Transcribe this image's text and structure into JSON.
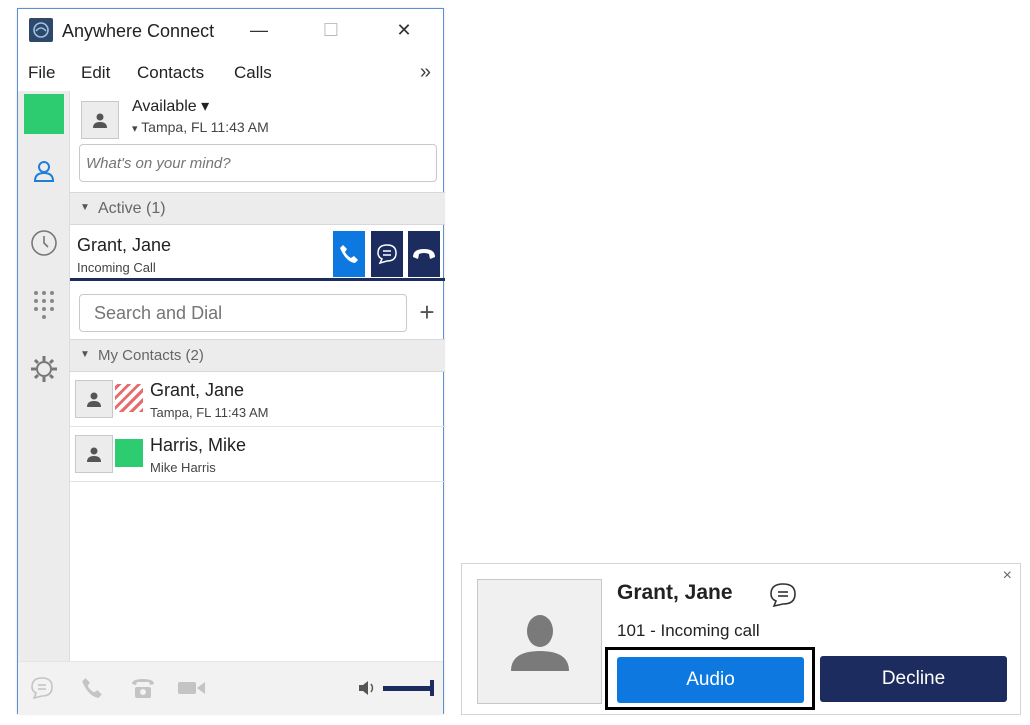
{
  "window": {
    "title": "Anywhere Connect",
    "minimize_glyph": "—",
    "maximize_glyph": "☐",
    "close_glyph": "✕"
  },
  "menu": {
    "items": [
      "File",
      "Edit",
      "Contacts",
      "Calls"
    ],
    "more_glyph": "»"
  },
  "profile": {
    "status": "Available ▾",
    "location": "Tampa, FL  11:43 AM",
    "mind_placeholder": "What's on your mind?"
  },
  "active_section": {
    "label": "Active (1)",
    "call": {
      "name": "Grant, Jane",
      "status": "Incoming Call"
    }
  },
  "search": {
    "placeholder": "Search and Dial",
    "add_glyph": "+"
  },
  "contacts_section": {
    "label": "My Contacts (2)",
    "contacts": [
      {
        "name": "Grant, Jane",
        "detail": "Tampa, FL  11:43 AM",
        "presence": "busy"
      },
      {
        "name": "Harris, Mike",
        "detail": "Mike Harris",
        "presence": "available"
      }
    ]
  },
  "sidebar_icons": [
    "contacts-icon",
    "history-icon",
    "dialpad-icon",
    "settings-icon"
  ],
  "toast": {
    "name": "Grant, Jane",
    "detail": "101 - Incoming call",
    "audio_label": "Audio",
    "decline_label": "Decline",
    "close_glyph": "×"
  },
  "colors": {
    "accent_blue": "#0d79e0",
    "navy": "#1d2c5e",
    "presence_green": "#2ecc71",
    "busy_red": "#e86b6b"
  }
}
